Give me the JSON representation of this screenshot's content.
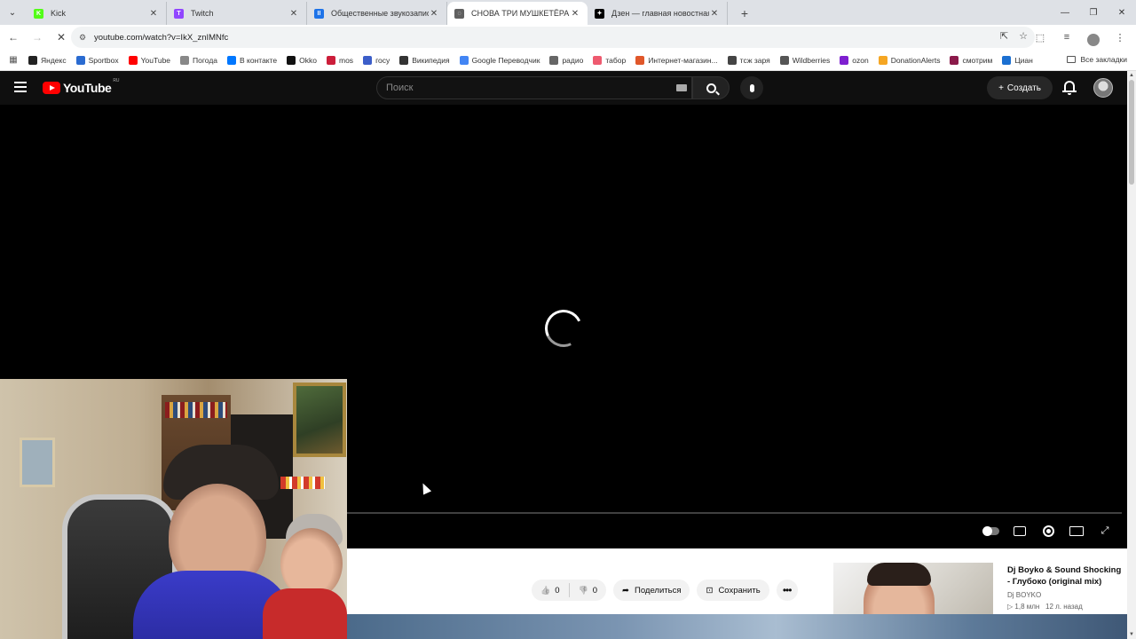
{
  "browser": {
    "tabs": [
      {
        "title": "Kick",
        "color": "#53fc18",
        "glyph": "K",
        "active": false
      },
      {
        "title": "Twitch",
        "color": "#9146ff",
        "glyph": "T",
        "active": false
      },
      {
        "title": "Общественные звукозаписи",
        "color": "#1e73e8",
        "glyph": "II",
        "active": false
      },
      {
        "title": "СНОВА ТРИ МУШКЕТЁРА НА Н",
        "color": "#606060",
        "glyph": "◌",
        "active": true
      },
      {
        "title": "Дзен — главная новостная ин",
        "color": "#000000",
        "glyph": "✦",
        "active": false
      }
    ],
    "url": "youtube.com/watch?v=IkX_znIMNfc",
    "bookmarks": [
      {
        "label": "Яндекс",
        "color": "#222222"
      },
      {
        "label": "Sportbox",
        "color": "#2a6bd1"
      },
      {
        "label": "YouTube",
        "color": "#ff0000"
      },
      {
        "label": "Погода",
        "color": "#888888"
      },
      {
        "label": "В контакте",
        "color": "#0077ff"
      },
      {
        "label": "Okko",
        "color": "#111111"
      },
      {
        "label": "mos",
        "color": "#cc1e3a"
      },
      {
        "label": "госу",
        "color": "#3c5ec9"
      },
      {
        "label": "Википедия",
        "color": "#333333"
      },
      {
        "label": "Google Переводчик",
        "color": "#4285f4"
      },
      {
        "label": "радио",
        "color": "#666666"
      },
      {
        "label": "табор",
        "color": "#ee5a6f"
      },
      {
        "label": "Интернет-магазин...",
        "color": "#e0572a"
      },
      {
        "label": "тсж заря",
        "color": "#444444"
      },
      {
        "label": "Wildberries",
        "color": "#555555"
      },
      {
        "label": "ozon",
        "color": "#7e1fd0"
      },
      {
        "label": "DonationAlerts",
        "color": "#f5a623"
      },
      {
        "label": "смотрим",
        "color": "#8b1a4a"
      },
      {
        "label": "Циан",
        "color": "#1b6fd1"
      }
    ],
    "all_bookmarks": "Все закладки"
  },
  "youtube": {
    "logo_text": "YouTube",
    "region": "RU",
    "search_placeholder": "Поиск",
    "create_label": "Создать",
    "actions": {
      "likes": "0",
      "dislikes": "0",
      "share": "Поделиться",
      "save": "Сохранить"
    },
    "recommendation": {
      "title": "Dj Boyko & Sound Shocking - Глубоко (original mix)",
      "channel": "Dj BOYKO",
      "views": "1,8 млн",
      "age": "12 л. назад"
    }
  }
}
